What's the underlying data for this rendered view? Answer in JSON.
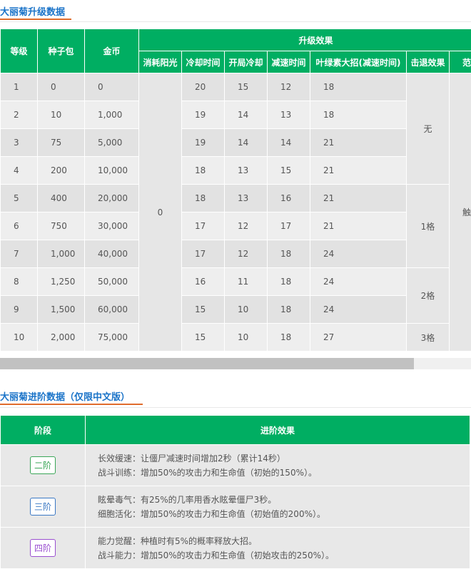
{
  "section1": {
    "title": "大丽菊升级数据"
  },
  "upgrade_table": {
    "headers": {
      "level": "等级",
      "seed": "种子包",
      "coin": "金币",
      "effect_group": "升级效果",
      "sun": "消耗阳光",
      "cooldown": "冷却时间",
      "start_cd": "开局冷却",
      "slow": "减速时间",
      "ult": "叶绿素大招(减速时间)",
      "knockback": "击退效果",
      "range": "范"
    },
    "rows": [
      {
        "level": "1",
        "seed": "0",
        "coin": "0",
        "cooldown": "20",
        "start_cd": "15",
        "slow": "12",
        "ult": "18"
      },
      {
        "level": "2",
        "seed": "10",
        "coin": "1,000",
        "cooldown": "19",
        "start_cd": "14",
        "slow": "13",
        "ult": "18"
      },
      {
        "level": "3",
        "seed": "75",
        "coin": "5,000",
        "cooldown": "19",
        "start_cd": "14",
        "slow": "14",
        "ult": "21"
      },
      {
        "level": "4",
        "seed": "200",
        "coin": "10,000",
        "cooldown": "18",
        "start_cd": "13",
        "slow": "15",
        "ult": "21"
      },
      {
        "level": "5",
        "seed": "400",
        "coin": "20,000",
        "cooldown": "18",
        "start_cd": "13",
        "slow": "16",
        "ult": "21"
      },
      {
        "level": "6",
        "seed": "750",
        "coin": "30,000",
        "cooldown": "17",
        "start_cd": "12",
        "slow": "17",
        "ult": "21"
      },
      {
        "level": "7",
        "seed": "1,000",
        "coin": "40,000",
        "cooldown": "17",
        "start_cd": "12",
        "slow": "18",
        "ult": "24"
      },
      {
        "level": "8",
        "seed": "1,250",
        "coin": "50,000",
        "cooldown": "16",
        "start_cd": "11",
        "slow": "18",
        "ult": "24"
      },
      {
        "level": "9",
        "seed": "1,500",
        "coin": "60,000",
        "cooldown": "15",
        "start_cd": "10",
        "slow": "18",
        "ult": "24"
      },
      {
        "level": "10",
        "seed": "2,000",
        "coin": "75,000",
        "cooldown": "15",
        "start_cd": "10",
        "slow": "18",
        "ult": "27"
      }
    ],
    "sun_cost": "0",
    "knockback": {
      "none": "无",
      "one": "1格",
      "two": "2格",
      "three": "3格"
    },
    "range_value": "触"
  },
  "section2": {
    "title": "大丽菊进阶数据（仅限中文版）"
  },
  "advance_table": {
    "headers": {
      "stage": "阶段",
      "effect": "进阶效果"
    },
    "rows": [
      {
        "stage": "二阶",
        "color": "#3aa657",
        "line1": "长效缓速：让僵尸减速时间增加2秒（累计14秒）",
        "line2": "战斗训练：增加50%的攻击力和生命值（初始的150%）。"
      },
      {
        "stage": "三阶",
        "color": "#3a78c4",
        "line1": "眩晕毒气：有25%的几率用香水眩晕僵尸3秒。",
        "line2": "细胞活化：增加50%的攻击力和生命值（初始值的200%）。"
      },
      {
        "stage": "四阶",
        "color": "#9a4fd0",
        "line1": "能力觉醒：种植时有5%的概率释放大招。",
        "line2": "战斗能力：增加50%的攻击力和生命值（初始攻击的250%）。"
      }
    ]
  },
  "colors": {
    "header_green": "#00ae62",
    "title_blue": "#1a73c8",
    "accent_orange": "#e06c2c"
  }
}
